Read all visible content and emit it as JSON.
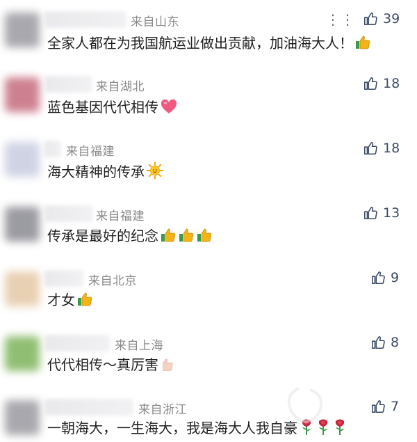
{
  "comments": [
    {
      "location": "来自山东",
      "text": "全家人都在为我国航运业做出贡献，加油海大人！",
      "likes": "39",
      "emojis": [
        "thumbs-up"
      ],
      "has_more": true,
      "avatar_color": "#9a9aa0"
    },
    {
      "location": "来自湖北",
      "text": "蓝色基因代代相传",
      "likes": "18",
      "emojis": [
        "heart"
      ],
      "avatar_color": "#c56b7d"
    },
    {
      "location": "来自福建",
      "text": "海大精神的传承",
      "likes": "18",
      "emojis": [
        "sun"
      ],
      "avatar_color": "#c8cce0"
    },
    {
      "location": "来自福建",
      "text": "传承是最好的纪念",
      "likes": "13",
      "emojis": [
        "thumbs-up",
        "thumbs-up",
        "thumbs-up"
      ],
      "avatar_color": "#8a8a92"
    },
    {
      "location": "来自北京",
      "text": "才女",
      "likes": "9",
      "emojis": [
        "thumbs-up"
      ],
      "avatar_color": "#e4c8a6"
    },
    {
      "location": "来自上海",
      "text": "代代相传～真厉害",
      "likes": "8",
      "emojis": [
        "thumbs-up-light"
      ],
      "avatar_color": "#7db35a"
    },
    {
      "location": "来自浙江",
      "text": "一朝海大，一生海大，我是海大人我自豪",
      "likes": "7",
      "emojis": [
        "rose",
        "rose",
        "rose"
      ],
      "avatar_color": "#9a9aa0"
    }
  ],
  "colors": {
    "like_icon": "#3d4b66",
    "location": "#8a8a8a"
  }
}
